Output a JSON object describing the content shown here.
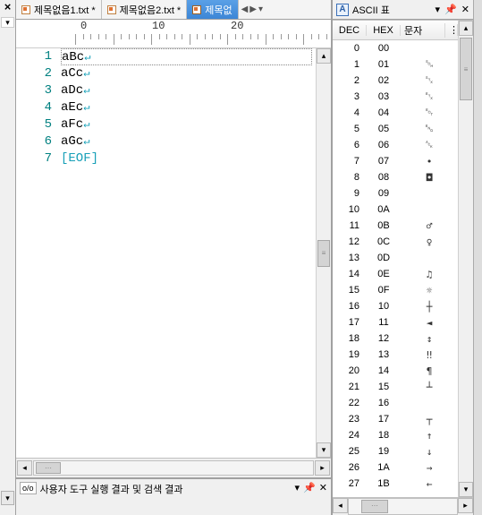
{
  "tabs": [
    {
      "label": "제목없음1.txt *",
      "active": false
    },
    {
      "label": "제목없음2.txt *",
      "active": false
    },
    {
      "label": "제목없",
      "active": true
    }
  ],
  "tab_nav": {
    "left": "◀",
    "right": "▶",
    "menu": "▾"
  },
  "ruler": {
    "marks": [
      "0",
      "10",
      "20"
    ]
  },
  "lines": [
    {
      "num": "1",
      "text": "aBc",
      "ret": "↵",
      "first": true
    },
    {
      "num": "2",
      "text": "aCc",
      "ret": "↵"
    },
    {
      "num": "3",
      "text": "aDc",
      "ret": "↵"
    },
    {
      "num": "4",
      "text": "aEc",
      "ret": "↵"
    },
    {
      "num": "5",
      "text": "aFc",
      "ret": "↵"
    },
    {
      "num": "6",
      "text": "aGc",
      "ret": "↵"
    },
    {
      "num": "7",
      "text": "[EOF]",
      "eof": true
    }
  ],
  "output_panel": {
    "badge": "ᴏ/ᴏ",
    "title": "사용자 도구 실행 결과 및 검색 결과",
    "menu": "▾",
    "pin": "📌",
    "close": "✕"
  },
  "ascii_panel": {
    "icon": "A",
    "title": "ASCII 표",
    "menu": "▾",
    "pin": "📌",
    "close": "✕",
    "headers": {
      "dec": "DEC",
      "hex": "HEX",
      "char": "문자",
      "ext": "⋮"
    },
    "rows": [
      {
        "dec": "0",
        "hex": "00",
        "ch": ""
      },
      {
        "dec": "1",
        "hex": "01",
        "ch": "␁"
      },
      {
        "dec": "2",
        "hex": "02",
        "ch": "␂"
      },
      {
        "dec": "3",
        "hex": "03",
        "ch": "␃"
      },
      {
        "dec": "4",
        "hex": "04",
        "ch": "␄"
      },
      {
        "dec": "5",
        "hex": "05",
        "ch": "␅"
      },
      {
        "dec": "6",
        "hex": "06",
        "ch": "␆"
      },
      {
        "dec": "7",
        "hex": "07",
        "ch": "•"
      },
      {
        "dec": "8",
        "hex": "08",
        "ch": "◘"
      },
      {
        "dec": "9",
        "hex": "09",
        "ch": ""
      },
      {
        "dec": "10",
        "hex": "0A",
        "ch": ""
      },
      {
        "dec": "11",
        "hex": "0B",
        "ch": "♂"
      },
      {
        "dec": "12",
        "hex": "0C",
        "ch": "♀"
      },
      {
        "dec": "13",
        "hex": "0D",
        "ch": ""
      },
      {
        "dec": "14",
        "hex": "0E",
        "ch": "♫"
      },
      {
        "dec": "15",
        "hex": "0F",
        "ch": "☼"
      },
      {
        "dec": "16",
        "hex": "10",
        "ch": "┼"
      },
      {
        "dec": "17",
        "hex": "11",
        "ch": "◄"
      },
      {
        "dec": "18",
        "hex": "12",
        "ch": "↕"
      },
      {
        "dec": "19",
        "hex": "13",
        "ch": "‼"
      },
      {
        "dec": "20",
        "hex": "14",
        "ch": "¶"
      },
      {
        "dec": "21",
        "hex": "15",
        "ch": "┴"
      },
      {
        "dec": "22",
        "hex": "16",
        "ch": ""
      },
      {
        "dec": "23",
        "hex": "17",
        "ch": "┬"
      },
      {
        "dec": "24",
        "hex": "18",
        "ch": "↑"
      },
      {
        "dec": "25",
        "hex": "19",
        "ch": "↓"
      },
      {
        "dec": "26",
        "hex": "1A",
        "ch": "→"
      },
      {
        "dec": "27",
        "hex": "1B",
        "ch": "←"
      }
    ]
  }
}
